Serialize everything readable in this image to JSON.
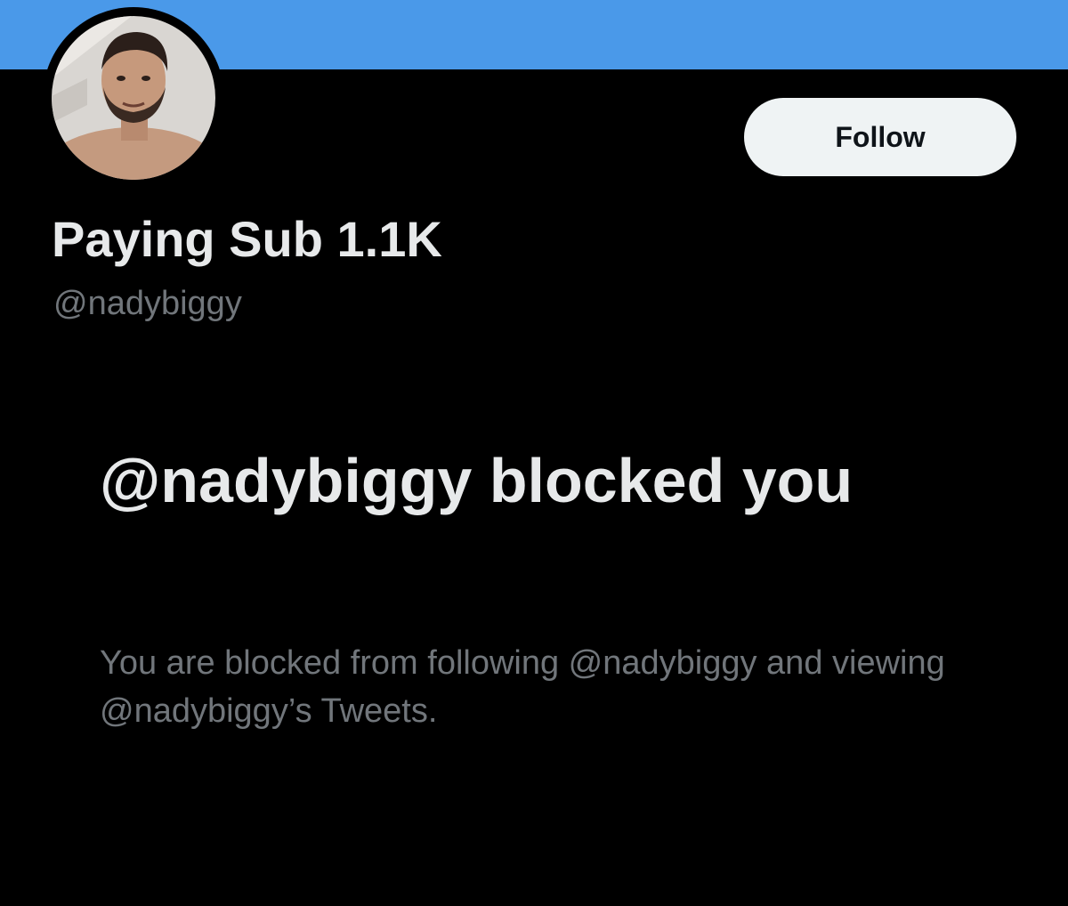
{
  "profile": {
    "display_name": "Paying Sub 1.1K",
    "handle": "@nadybiggy"
  },
  "actions": {
    "follow_label": "Follow"
  },
  "blocked_notice": {
    "title": "@nadybiggy blocked you",
    "description": "You are blocked from following @nadybiggy and viewing @nadybiggy’s Tweets."
  },
  "colors": {
    "banner": "#4a99e9",
    "background": "#000000",
    "primary_text": "#e7e9ea",
    "secondary_text": "#71767b",
    "button_bg": "#eff3f4"
  }
}
